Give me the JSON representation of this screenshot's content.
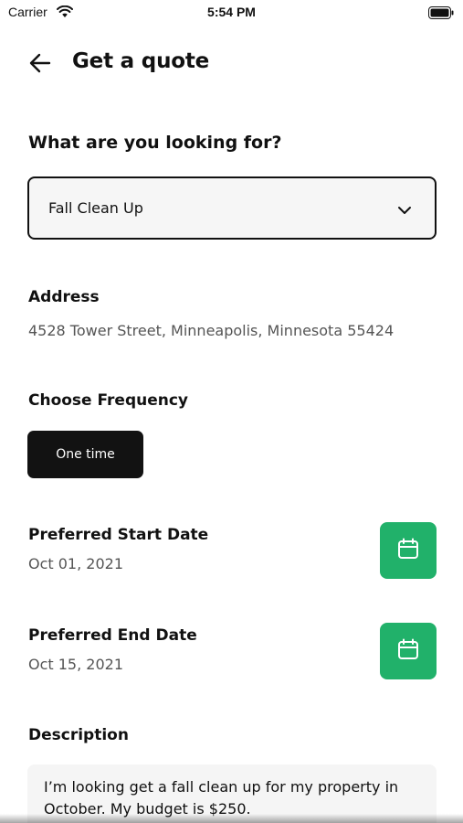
{
  "status": {
    "carrier": "Carrier",
    "time": "5:54 PM"
  },
  "header": {
    "title": "Get a quote"
  },
  "service": {
    "label": "What are you looking for?",
    "selected": "Fall Clean Up"
  },
  "address": {
    "label": "Address",
    "value": "4528 Tower Street, Minneapolis, Minnesota 55424"
  },
  "frequency": {
    "label": "Choose Frequency",
    "selected": "One time"
  },
  "start_date": {
    "label": "Preferred Start Date",
    "value": "Oct 01, 2021"
  },
  "end_date": {
    "label": "Preferred End Date",
    "value": "Oct 15, 2021"
  },
  "description": {
    "label": "Description",
    "value": "I’m looking get a fall clean up for my property in October. My budget is $250."
  },
  "colors": {
    "accent_green": "#21b16a",
    "dark": "#121212"
  },
  "icons": {
    "back": "arrow-left-icon",
    "dropdown": "chevron-down-icon",
    "calendar": "calendar-icon",
    "wifi": "wifi-icon",
    "battery": "battery-icon"
  }
}
